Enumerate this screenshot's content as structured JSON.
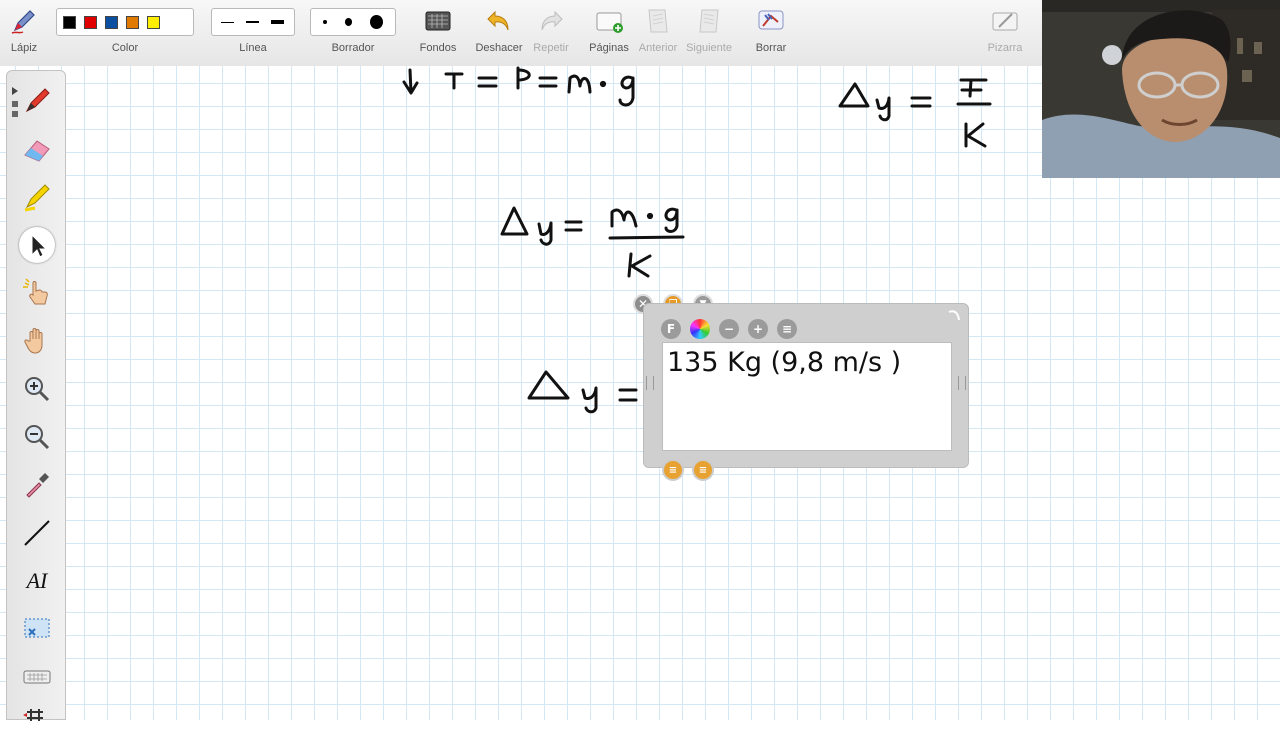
{
  "toolbar": {
    "pen_label": "Lápiz",
    "color_label": "Color",
    "line_label": "Línea",
    "eraser_label": "Borrador",
    "backgrounds_label": "Fondos",
    "undo_label": "Deshacer",
    "redo_label": "Repetir",
    "pages_label": "Páginas",
    "previous_label": "Anterior",
    "next_label": "Siguiente",
    "clear_label": "Borrar",
    "board_label": "Pizarra",
    "colors": [
      "#000000",
      "#e00000",
      "#0a4fa0",
      "#e07a00",
      "#ffee00"
    ]
  },
  "sidebar": {
    "tools": [
      "pen-icon",
      "eraser-icon",
      "highlighter-icon",
      "pointer-icon",
      "laser-hand-icon",
      "pan-hand-icon",
      "zoom-in-icon",
      "zoom-out-icon",
      "eyedropper-icon",
      "line-tool-icon",
      "text-tool-icon",
      "screen-capture-icon",
      "keyboard-icon",
      "table-icon"
    ],
    "text_tool_glyph": "AI",
    "active_tool": "pointer-icon"
  },
  "textbox": {
    "content": "135 Kg (9,8 m/s )",
    "font_button": "F",
    "minus_button": "−",
    "plus_button": "+",
    "align_button": "≡"
  }
}
